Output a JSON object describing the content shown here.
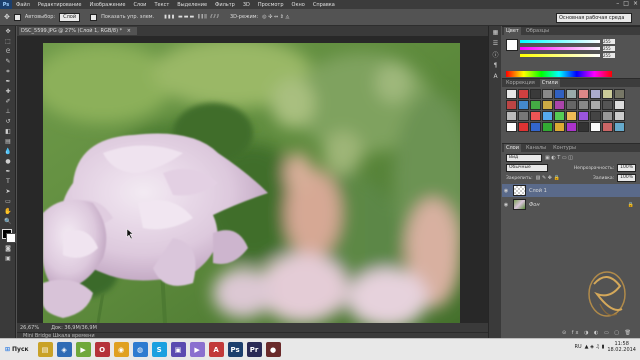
{
  "menubar": {
    "logo": "Ps",
    "items": [
      "Файл",
      "Редактирование",
      "Изображение",
      "Слои",
      "Текст",
      "Выделение",
      "Фильтр",
      "3D",
      "Просмотр",
      "Окно",
      "Справка"
    ]
  },
  "options": {
    "autoselect_label": "Автовыбор:",
    "autoselect_value": "Слой",
    "show_controls_label": "Показать упр. элем.",
    "mode_3d_label": "3D-режим:",
    "workspace": "Основная рабочая среда"
  },
  "document": {
    "tab_title": "DSC_5599.JPG @ 27% (Слой 1, RGB/8) *",
    "zoom": "26,67%",
    "doc_info": "Док: 36,9M/36,9M",
    "minibridge": "Mini Bridge  Шкала времени"
  },
  "panels": {
    "color_tabs": [
      "Цвет",
      "Образцы"
    ],
    "rgb_values": [
      "255",
      "255",
      "255"
    ],
    "styles_tabs": [
      "Коррекция",
      "Стили"
    ],
    "layers_tabs": [
      "Слои",
      "Каналы",
      "Контуры"
    ],
    "layer_filter": "Вид",
    "blend_mode": "Обычные",
    "opacity_label": "Непрозрачность:",
    "opacity_value": "100%",
    "lock_label": "Закрепить:",
    "fill_label": "Заливка:",
    "fill_value": "100%",
    "layers": [
      {
        "name": "Слой 1"
      },
      {
        "name": "Фон"
      }
    ]
  },
  "taskbar": {
    "start_label": "Пуск",
    "lang": "RU",
    "time": "11:58",
    "date": "18.02.2014"
  },
  "colors": {
    "accent": "#1c3f6d",
    "panel_bg": "#535353",
    "dark_bg": "#3a3a3a"
  },
  "icons": {
    "tools": [
      "move-tool",
      "marquee-tool",
      "lasso-tool",
      "quick-select-tool",
      "crop-tool",
      "eyedropper-tool",
      "healing-tool",
      "brush-tool",
      "clone-stamp-tool",
      "history-brush-tool",
      "eraser-tool",
      "gradient-tool",
      "blur-tool",
      "dodge-tool",
      "pen-tool",
      "type-tool",
      "path-select-tool",
      "shape-tool",
      "hand-tool",
      "zoom-tool"
    ]
  }
}
